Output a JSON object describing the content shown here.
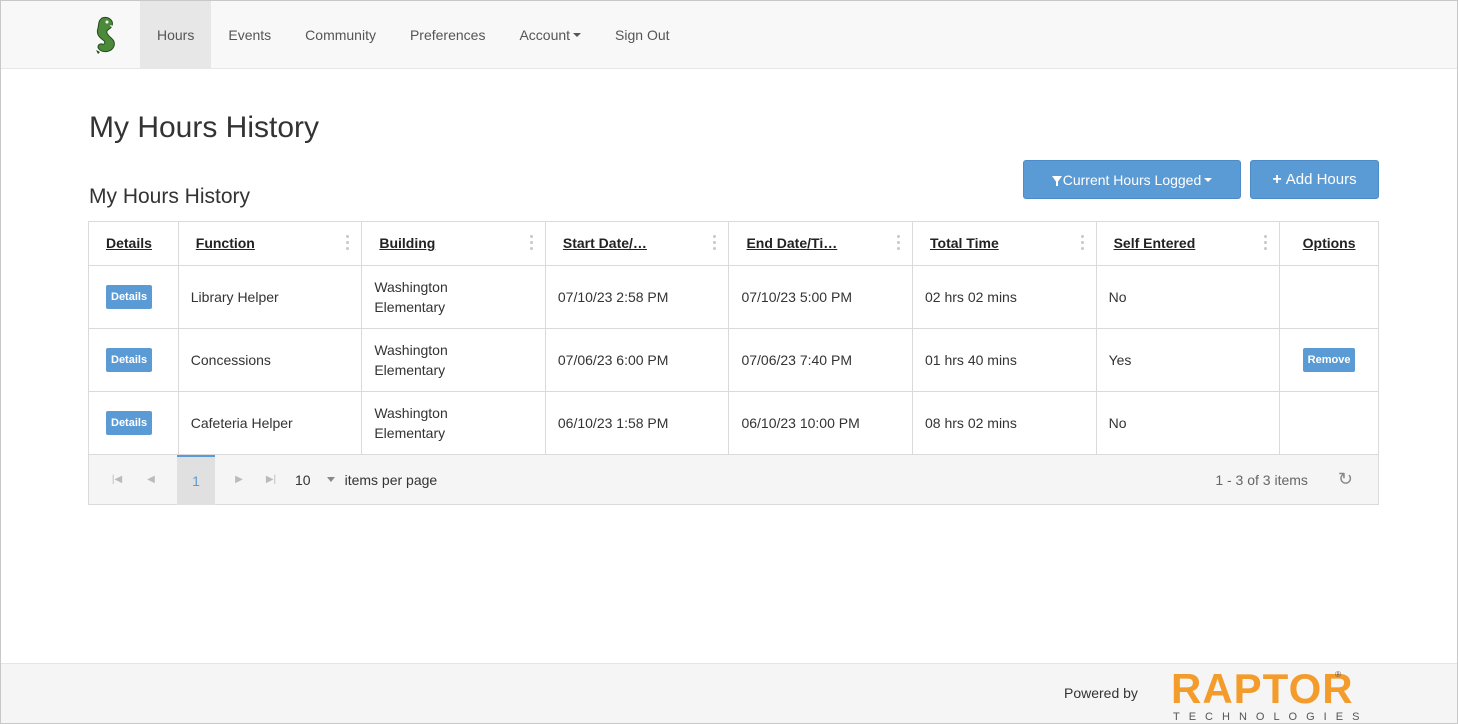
{
  "nav": {
    "items": [
      {
        "label": "Hours",
        "active": true
      },
      {
        "label": "Events",
        "active": false
      },
      {
        "label": "Community",
        "active": false
      },
      {
        "label": "Preferences",
        "active": false
      },
      {
        "label": "Account",
        "active": false,
        "dropdown": true
      },
      {
        "label": "Sign Out",
        "active": false
      }
    ]
  },
  "page": {
    "title": "My Hours History",
    "section_title": "My Hours History"
  },
  "toolbar": {
    "filter_label": "Current Hours Logged",
    "add_label": "Add Hours"
  },
  "table": {
    "columns": [
      "Details",
      "Function",
      "Building",
      "Start Date/…",
      "End Date/Ti…",
      "Total Time",
      "Self Entered",
      "Options"
    ],
    "rows": [
      {
        "details": "Details",
        "function": "Library Helper",
        "building_line1": "Washington",
        "building_line2": "Elementary",
        "start": "07/10/23 2:58 PM",
        "end": "07/10/23 5:00 PM",
        "total": "02 hrs 02 mins",
        "self": "No",
        "option": ""
      },
      {
        "details": "Details",
        "function": "Concessions",
        "building_line1": "Washington",
        "building_line2": "Elementary",
        "start": "07/06/23 6:00 PM",
        "end": "07/06/23 7:40 PM",
        "total": "01 hrs 40 mins",
        "self": "Yes",
        "option": "Remove"
      },
      {
        "details": "Details",
        "function": "Cafeteria Helper",
        "building_line1": "Washington",
        "building_line2": "Elementary",
        "start": "06/10/23 1:58 PM",
        "end": "06/10/23 10:00 PM",
        "total": "08 hrs 02 mins",
        "self": "No",
        "option": ""
      }
    ]
  },
  "pager": {
    "current_page": "1",
    "page_size": "10",
    "page_size_label": "items per page",
    "info": "1 - 3 of 3 items"
  },
  "footer": {
    "powered_by": "Powered by",
    "brand": "RAPTOR",
    "brand_sub": "TECHNOLOGIES",
    "brand_mark": "®"
  },
  "colors": {
    "accent": "#5b9bd5",
    "brand_orange": "#f39c2c"
  }
}
